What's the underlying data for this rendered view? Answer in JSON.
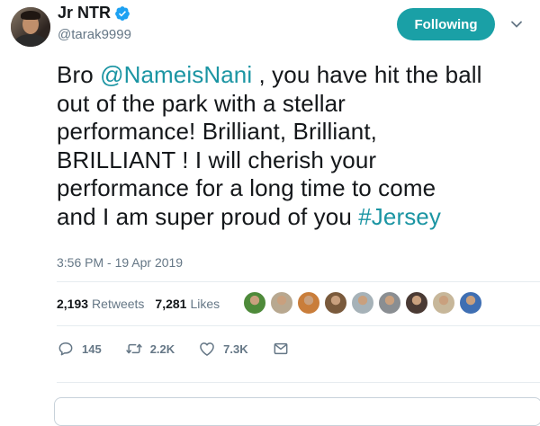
{
  "user": {
    "display_name": "Jr NTR",
    "handle": "@tarak9999",
    "follow_label": "Following"
  },
  "tweet": {
    "segments": [
      [
        {
          "t": "Bro ",
          "link": false
        },
        {
          "t": "@NameisNani",
          "link": true
        },
        {
          "t": " , you have hit the ball",
          "link": false
        }
      ],
      [
        {
          "t": "out of the park with a stellar",
          "link": false
        }
      ],
      [
        {
          "t": "performance! Brilliant, Brilliant,",
          "link": false
        }
      ],
      [
        {
          "t": "BRILLIANT ! I will cherish your",
          "link": false
        }
      ],
      [
        {
          "t": "performance for a long time to come",
          "link": false
        }
      ],
      [
        {
          "t": "and I am super proud of you ",
          "link": false
        },
        {
          "t": "#Jersey",
          "link": true
        }
      ]
    ],
    "timestamp": "3:56 PM - 19 Apr 2019"
  },
  "stats": {
    "retweets_count": "2,193",
    "retweets_label": "Retweets",
    "likes_count": "7,281",
    "likes_label": "Likes"
  },
  "liker_avatars": [
    "#4e8a3a",
    "#b8a890",
    "#c97d3a",
    "#7a5a3c",
    "#a6b2b8",
    "#8a8e92",
    "#4a3a34",
    "#c7b79a",
    "#3f6fb3"
  ],
  "actions": {
    "reply_count": "145",
    "retweet_count": "2.2K",
    "like_count": "7.3K"
  },
  "colors": {
    "accent": "#1b95a3",
    "follow_bg": "#1aa0a6",
    "verified": "#1da1f2"
  }
}
